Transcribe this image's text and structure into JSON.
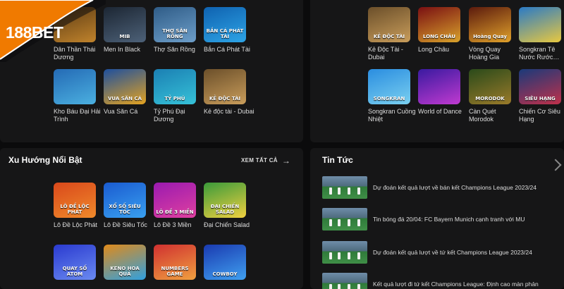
{
  "brand": {
    "logo_text": "188BET",
    "accent": "#f07a00"
  },
  "top_left_games": [
    {
      "label": "Dân Thần Thái Dương",
      "thumb_text": "",
      "colors": [
        "#5a3a14",
        "#c0832c"
      ]
    },
    {
      "label": "Men In Black",
      "thumb_text": "MIB",
      "colors": [
        "#1c2633",
        "#4d6178"
      ]
    },
    {
      "label": "Thợ Săn Rồng",
      "thumb_text": "THỢ SĂN RỒNG",
      "colors": [
        "#2f5c87",
        "#6d9ec9"
      ]
    },
    {
      "label": "Bắn Cá Phát Tài",
      "thumb_text": "BẮN CÁ PHÁT TÀI",
      "colors": [
        "#0f62b0",
        "#2ea4e6"
      ]
    },
    {
      "label": "Kho Báu Đại Hải Trình",
      "thumb_text": "",
      "colors": [
        "#246ab5",
        "#4bb0e0"
      ]
    },
    {
      "label": "Vua Săn Cá",
      "thumb_text": "VUA SĂN CÁ",
      "colors": [
        "#1d4f9e",
        "#e3a220"
      ]
    },
    {
      "label": "Tỷ Phú Đại Dương",
      "thumb_text": "TỶ PHÚ",
      "colors": [
        "#1b7fb3",
        "#36c2d8"
      ]
    },
    {
      "label": "Kẻ độc tài - Dubai",
      "thumb_text": "KẺ ĐỘC TÀI",
      "colors": [
        "#6b4f2a",
        "#c99d5b"
      ]
    }
  ],
  "top_right_games": [
    {
      "label": "Kẻ Độc Tài - Dubai",
      "thumb_text": "KẺ ĐỘC TÀI",
      "colors": [
        "#6b4f2a",
        "#c99d5b"
      ]
    },
    {
      "label": "Long Châu",
      "thumb_text": "LONG CHÂU",
      "colors": [
        "#7a0f12",
        "#d8a22b"
      ]
    },
    {
      "label": "Vòng Quay Hoàng Gia",
      "thumb_text": "Hoàng Quay",
      "colors": [
        "#5b1a0d",
        "#e0a12b"
      ]
    },
    {
      "label": "Songkran Tê Nước Rước…",
      "thumb_text": "",
      "colors": [
        "#2a7ac6",
        "#e8c840"
      ]
    },
    {
      "label": "Songkran Cuồng Nhiệt",
      "thumb_text": "SONGKRAN",
      "colors": [
        "#2a8de0",
        "#7ad0f0"
      ]
    },
    {
      "label": "World of Dance",
      "thumb_text": "",
      "colors": [
        "#3a1aa0",
        "#c03ad0"
      ]
    },
    {
      "label": "Càn Quét Morodok",
      "thumb_text": "MORODOK",
      "colors": [
        "#2a4a1a",
        "#9a7a2a"
      ]
    },
    {
      "label": "Chiến Cơ Siêu Hạng",
      "thumb_text": "SIÊU HẠNG",
      "colors": [
        "#1a3a7a",
        "#c0304a"
      ]
    }
  ],
  "trending": {
    "title": "Xu Hướng Nổi Bật",
    "see_all": "XEM TẤT CẢ",
    "games": [
      {
        "label": "Lô Đề Lộc Phát",
        "thumb_text": "LÔ ĐỀ LỘC PHÁT",
        "colors": [
          "#d9481b",
          "#f08a2b"
        ]
      },
      {
        "label": "Lô Đề Siêu Tốc",
        "thumb_text": "XỔ SỐ SIÊU TỐC",
        "colors": [
          "#1a5bd0",
          "#39a0f0"
        ]
      },
      {
        "label": "Lô Đề 3 Miền",
        "thumb_text": "LÔ ĐỀ 3 MIỀN",
        "colors": [
          "#9a1ab0",
          "#e040a0"
        ]
      },
      {
        "label": "Đại Chiến Salad",
        "thumb_text": "ĐẠI CHIẾN SALAD",
        "colors": [
          "#3a9a3a",
          "#f0d040"
        ]
      },
      {
        "label": "",
        "thumb_text": "QUAY SỐ ATOM",
        "colors": [
          "#2a3ad0",
          "#6a8af0"
        ]
      },
      {
        "label": "",
        "thumb_text": "KENO HOA QUẢ",
        "colors": [
          "#e08a1a",
          "#30a0e0"
        ]
      },
      {
        "label": "",
        "thumb_text": "NUMBERS GAME",
        "colors": [
          "#d03030",
          "#f0a040"
        ]
      },
      {
        "label": "",
        "thumb_text": "COWBOY",
        "colors": [
          "#1a3ab0",
          "#40a0f0"
        ]
      }
    ]
  },
  "news": {
    "title": "Tin Tức",
    "items": [
      "Dự đoán kết quả lượt về bán kết Champions League 2023/24",
      "Tin bóng đá 20/04: FC Bayern Munich cạnh tranh với MU",
      "Dự đoán kết quả lượt về tứ kết Champions League 2023/24",
      "Kết quả lượt đi tứ kết Champions League: Định cao màn phản"
    ]
  }
}
